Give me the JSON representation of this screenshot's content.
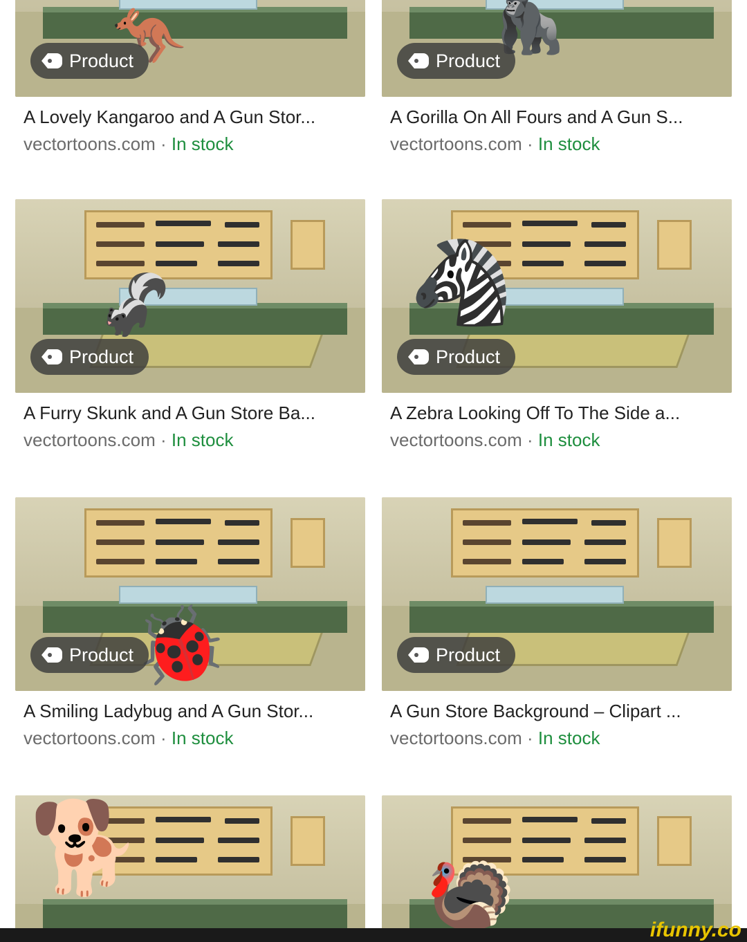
{
  "results": [
    {
      "title": "A Lovely Kangaroo and A Gun Stor...",
      "source": "vectortoons.com",
      "sep": " · ",
      "stock": "In stock",
      "badge": "Product",
      "glyph": "🦘"
    },
    {
      "title": "A Gorilla On All Fours and A Gun S...",
      "source": "vectortoons.com",
      "sep": " · ",
      "stock": "In stock",
      "badge": "Product",
      "glyph": "🦍"
    },
    {
      "title": "A Furry Skunk and A Gun Store Ba...",
      "source": "vectortoons.com",
      "sep": " · ",
      "stock": "In stock",
      "badge": "Product",
      "glyph": "🦨"
    },
    {
      "title": "A Zebra Looking Off To The Side a...",
      "source": "vectortoons.com",
      "sep": " · ",
      "stock": "In stock",
      "badge": "Product",
      "glyph": "🦓"
    },
    {
      "title": "A Smiling Ladybug and A Gun Stor...",
      "source": "vectortoons.com",
      "sep": " · ",
      "stock": "In stock",
      "badge": "Product",
      "glyph": "🐞"
    },
    {
      "title": "A Gun Store Background – Clipart ...",
      "source": "vectortoons.com",
      "sep": " · ",
      "stock": "In stock",
      "badge": "Product",
      "glyph": ""
    },
    {
      "title": "",
      "source": "",
      "sep": "",
      "stock": "",
      "badge": "",
      "glyph": "🐕"
    },
    {
      "title": "",
      "source": "",
      "sep": "",
      "stock": "",
      "badge": "",
      "glyph": "🦃"
    }
  ],
  "watermark": "ifunny.co",
  "colors": {
    "stock": "#1e8e3e",
    "badge_bg": "#3c3c3c"
  }
}
